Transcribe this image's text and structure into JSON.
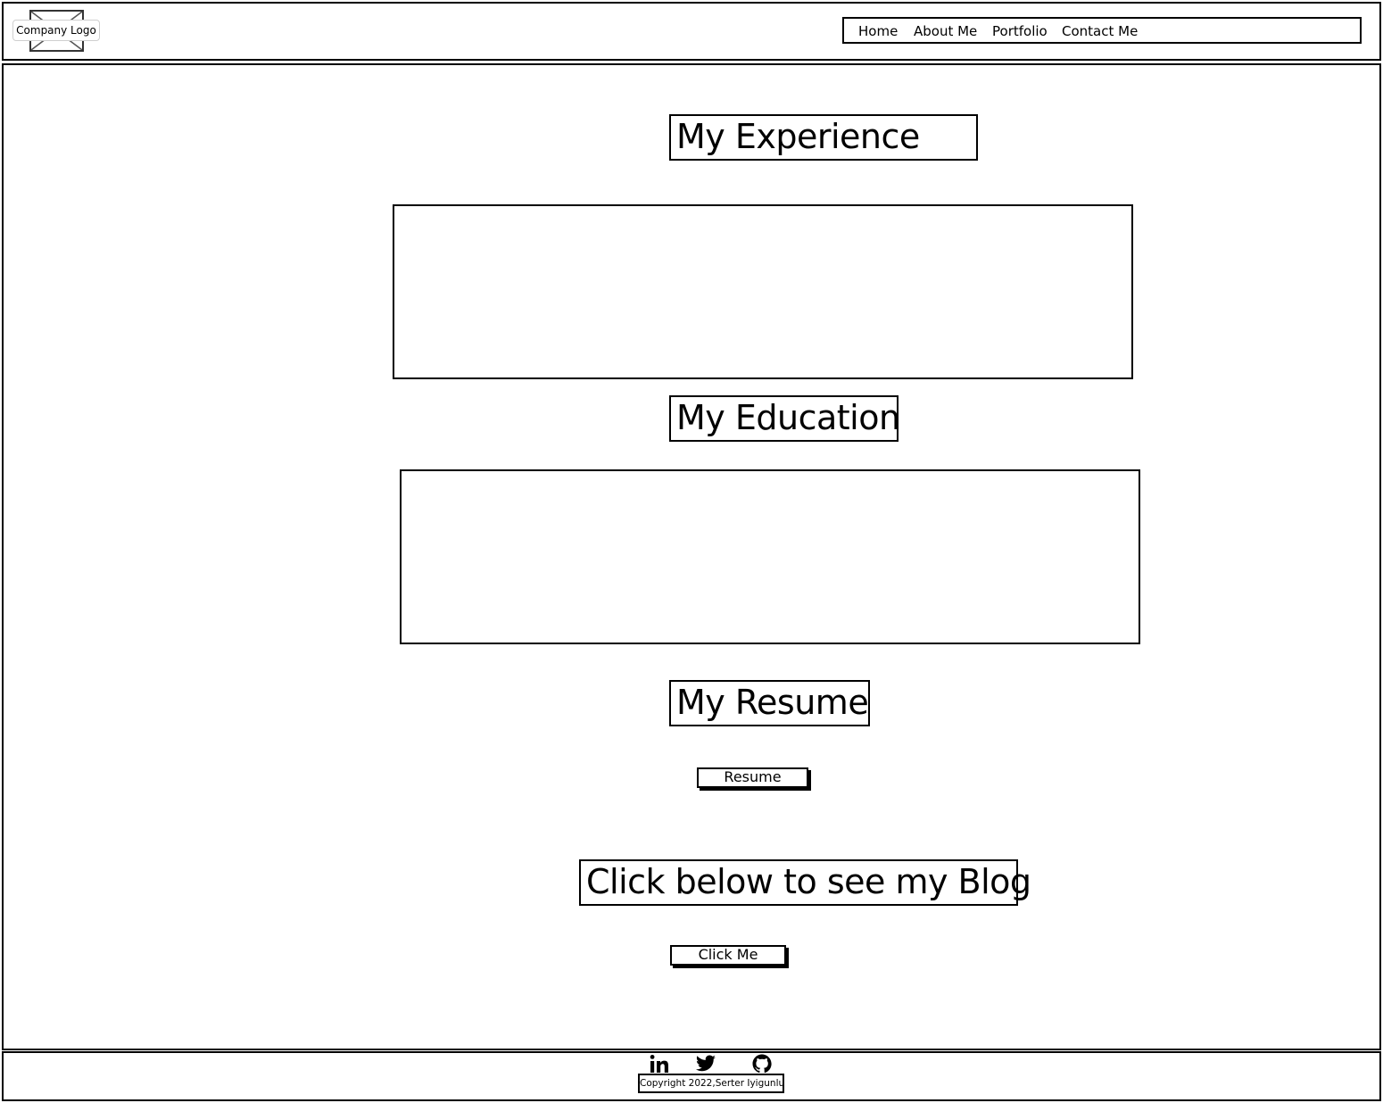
{
  "header": {
    "logo_label": "Company Logo",
    "nav": {
      "home": "Home",
      "about": "About Me",
      "portfolio": "Portfolio",
      "contact": "Contact Me"
    }
  },
  "main": {
    "experience_heading": "My Experience",
    "education_heading": "My Education",
    "resume_heading": "My Resume",
    "resume_button": "Resume",
    "blog_heading": "Click below to see my Blog",
    "blog_button": "Click Me"
  },
  "footer": {
    "social_icons": [
      "linkedin-icon",
      "twitter-icon",
      "github-icon"
    ],
    "copyright": "Copyright 2022,Serter Iyigunlu"
  }
}
